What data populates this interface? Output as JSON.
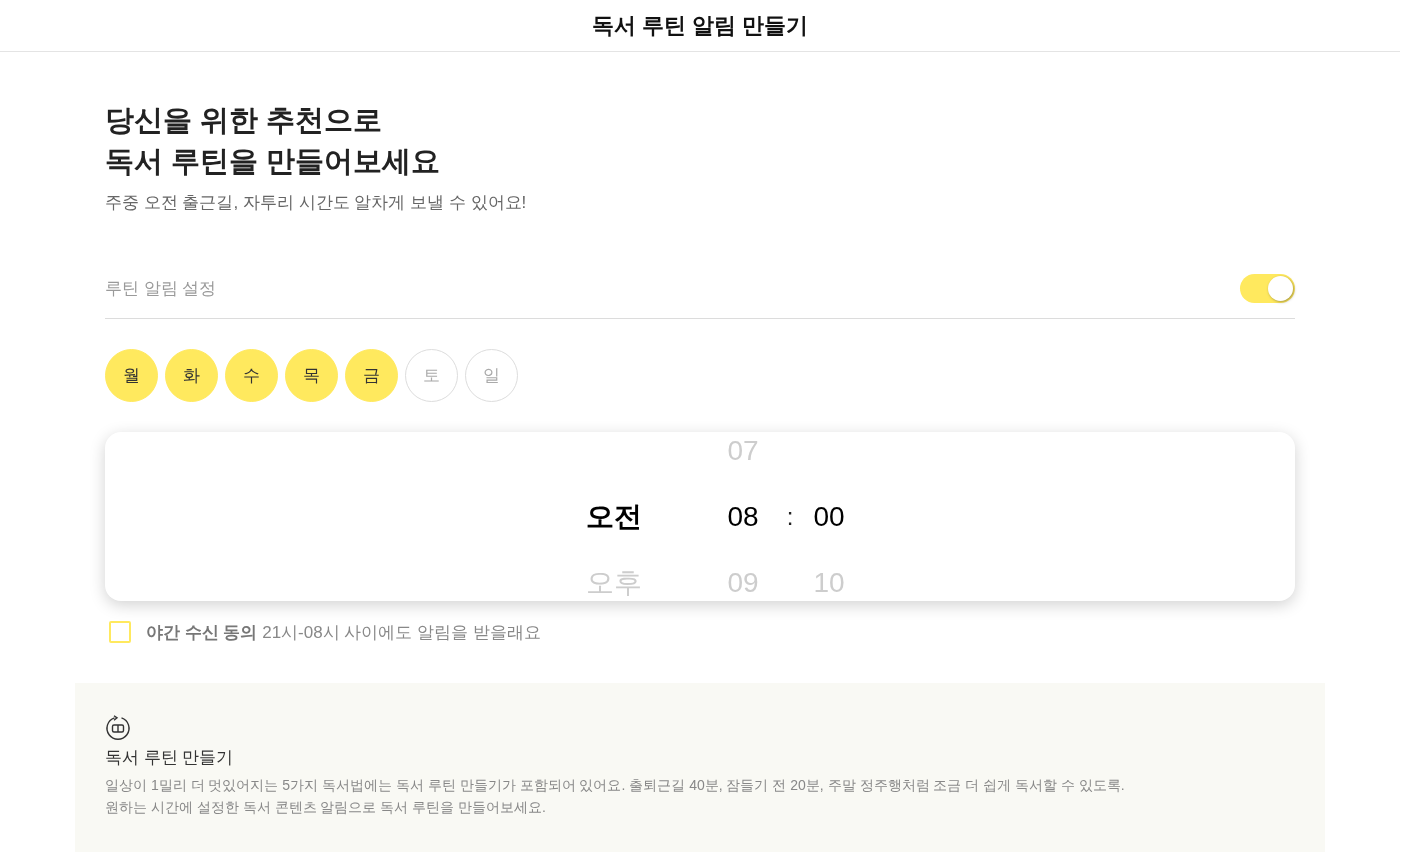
{
  "header": {
    "title": "독서 루틴 알림 만들기"
  },
  "intro": {
    "heading": "당신을 위한 추천으로\n독서 루틴을 만들어보세요",
    "subtitle": "주중 오전 출근길, 자투리 시간도 알차게 보낼 수 있어요!"
  },
  "routine_setting": {
    "label": "루틴 알림 설정",
    "on": true
  },
  "days": [
    {
      "label": "월",
      "selected": true
    },
    {
      "label": "화",
      "selected": true
    },
    {
      "label": "수",
      "selected": true
    },
    {
      "label": "목",
      "selected": true
    },
    {
      "label": "금",
      "selected": true
    },
    {
      "label": "토",
      "selected": false
    },
    {
      "label": "일",
      "selected": false
    }
  ],
  "time_picker": {
    "columns": [
      {
        "kind": "meridiem",
        "items": [
          {
            "label": "오전",
            "selected": true
          },
          {
            "label": "오후",
            "selected": false
          }
        ]
      },
      {
        "kind": "hour",
        "items": [
          {
            "label": "07",
            "selected": false
          },
          {
            "label": "08",
            "selected": true
          },
          {
            "label": "09",
            "selected": false
          }
        ]
      },
      {
        "kind": "separator",
        "label": ":"
      },
      {
        "kind": "minute",
        "items": [
          {
            "label": "00",
            "selected": true
          },
          {
            "label": "10",
            "selected": false
          }
        ]
      }
    ]
  },
  "night_consent": {
    "label": "**야간 수신 동의** 21시-08시 사이에도 알림을 받을래요",
    "checked": false
  },
  "info": {
    "title": "독서 루틴 만들기",
    "description": "일상이 1밀리 더 멋있어지는 5가지 독서법에는 독서 루틴 만들기가 포함되어 있어요. 출퇴근길 40분, 잠들기 전 20분, 주말 정주행처럼 조금 더 쉽게 독서할 수 있도록.\n원하는 시간에 설정한 독서 콘텐츠 알림으로 독서 루틴을 만들어보세요."
  }
}
